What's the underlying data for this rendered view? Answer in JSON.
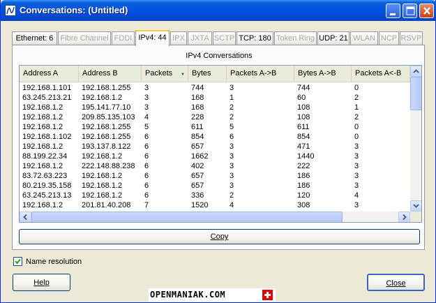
{
  "window": {
    "title": "Conversations: (Untitled)",
    "accent": "#0055e5",
    "icons": [
      "app-icon",
      "minimize-icon",
      "maximize-icon",
      "close-icon"
    ]
  },
  "tabs": [
    {
      "label": "Ethernet: 6",
      "enabled": true,
      "selected": false
    },
    {
      "label": "Fibre Channel",
      "enabled": false,
      "selected": false
    },
    {
      "label": "FDDI",
      "enabled": false,
      "selected": false
    },
    {
      "label": "IPv4: 44",
      "enabled": true,
      "selected": true
    },
    {
      "label": "IPX",
      "enabled": false,
      "selected": false
    },
    {
      "label": "JXTA",
      "enabled": false,
      "selected": false
    },
    {
      "label": "SCTP",
      "enabled": false,
      "selected": false
    },
    {
      "label": "TCP: 180",
      "enabled": true,
      "selected": false
    },
    {
      "label": "Token Ring",
      "enabled": false,
      "selected": false
    },
    {
      "label": "UDP: 21",
      "enabled": true,
      "selected": false
    },
    {
      "label": "WLAN",
      "enabled": false,
      "selected": false
    },
    {
      "label": "NCP",
      "enabled": false,
      "selected": false
    },
    {
      "label": "RSVP",
      "enabled": false,
      "selected": false
    }
  ],
  "panel": {
    "title": "IPv4 Conversations"
  },
  "table": {
    "columns": [
      "Address A",
      "Address B",
      "Packets",
      "Bytes",
      "Packets A->B",
      "Bytes A->B",
      "Packets A<-B"
    ],
    "sorted_column": "Packets",
    "rows": [
      [
        "192.168.1.101",
        "192.168.1.255",
        "3",
        "744",
        "3",
        "744",
        "0"
      ],
      [
        "63.245.213.21",
        "192.168.1.2",
        "3",
        "168",
        "1",
        "60",
        "2"
      ],
      [
        "192.168.1.2",
        "195.141.77.10",
        "3",
        "168",
        "2",
        "108",
        "1"
      ],
      [
        "192.168.1.2",
        "209.85.135.103",
        "4",
        "228",
        "2",
        "108",
        "2"
      ],
      [
        "192.168.1.2",
        "192.168.1.255",
        "5",
        "611",
        "5",
        "611",
        "0"
      ],
      [
        "192.168.1.102",
        "192.168.1.255",
        "6",
        "854",
        "6",
        "854",
        "0"
      ],
      [
        "192.168.1.2",
        "193.137.8.122",
        "6",
        "657",
        "3",
        "471",
        "3"
      ],
      [
        "88.199.22.34",
        "192.168.1.2",
        "6",
        "1662",
        "3",
        "1440",
        "3"
      ],
      [
        "192.168.1.2",
        "222.148.88.238",
        "6",
        "402",
        "3",
        "222",
        "3"
      ],
      [
        "83.72.63.223",
        "192.168.1.2",
        "6",
        "657",
        "3",
        "186",
        "3"
      ],
      [
        "80.219.35.158",
        "192.168.1.2",
        "6",
        "657",
        "3",
        "186",
        "3"
      ],
      [
        "63.245.213.13",
        "192.168.1.2",
        "6",
        "336",
        "2",
        "120",
        "4"
      ],
      [
        "192.168.1.2",
        "201.81.40.208",
        "7",
        "1520",
        "4",
        "308",
        "3"
      ]
    ]
  },
  "buttons": {
    "copy": "Copy",
    "help": "Help",
    "close": "Close"
  },
  "options": {
    "name_resolution_label": "Name resolution",
    "name_resolution_checked": true
  },
  "watermark": {
    "text": "OPENMANIAK.COM"
  }
}
